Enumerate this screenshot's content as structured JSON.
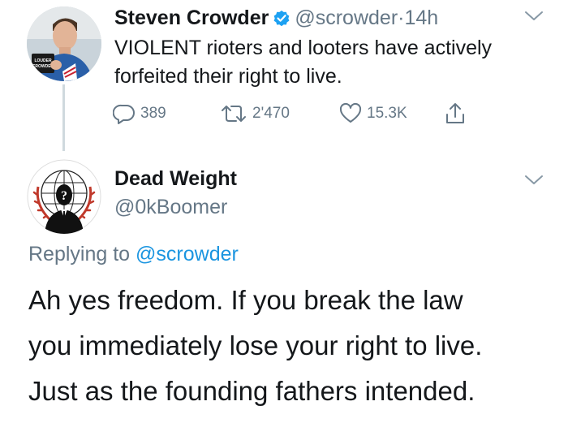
{
  "original_tweet": {
    "author_name": "Steven Crowder",
    "handle": "@scrowder",
    "separator": "·",
    "time": "14h",
    "text": "VIOLENT rioters and looters have actively forfeited their right to live.",
    "avatar_mug_text": "LOUDER WITH CROWDER",
    "stats": {
      "replies": "389",
      "retweets": "2'470",
      "likes": "15.3K"
    },
    "icons": {
      "verified": "verified-badge-icon",
      "reply": "reply-bubble-icon",
      "retweet": "retweet-icon",
      "like": "heart-icon",
      "share": "share-icon",
      "more": "chevron-down-icon"
    }
  },
  "reply_tweet": {
    "author_name": "Dead Weight",
    "handle": "@0kBoomer",
    "replying_prefix": "Replying to",
    "replying_mention": "@scrowder",
    "text_lines": [
      "Ah yes freedom. If you break the law",
      "you immediately lose your right to live.",
      "Just as the founding fathers intended."
    ],
    "avatar_symbol": "?"
  },
  "colors": {
    "text": "#14171a",
    "secondary": "#657786",
    "link": "#1b95e0",
    "verified": "#1da1f2",
    "thread_line": "#cfd9de"
  }
}
